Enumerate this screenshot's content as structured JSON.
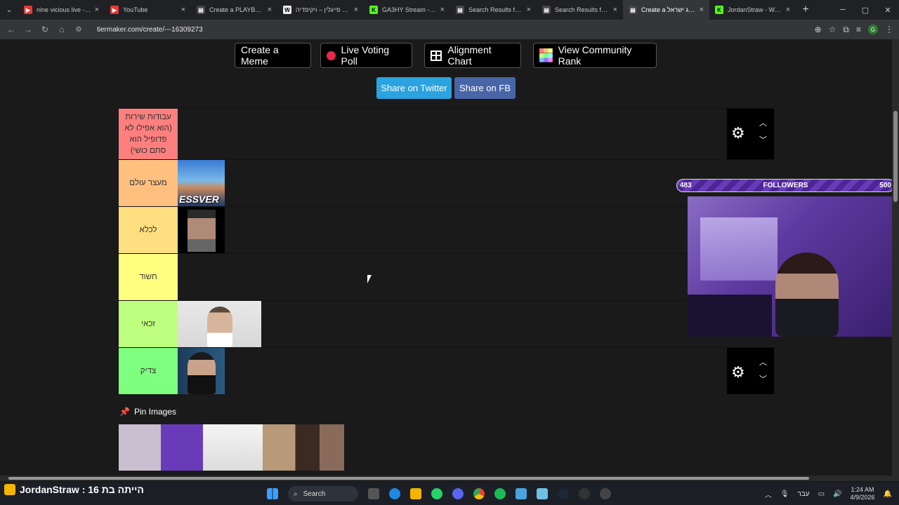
{
  "browser": {
    "tabs": [
      {
        "title": "nine vicious live - You",
        "fav": "▶",
        "favColor": "#e53935"
      },
      {
        "title": "YouTube",
        "fav": "▶",
        "favColor": "#e53935"
      },
      {
        "title": "Create a PLAYBOI CA",
        "fav": "▤",
        "favColor": "#444"
      },
      {
        "title": "משה פייגלין – ויקיפדיה",
        "fav": "W",
        "favColor": "#eee"
      },
      {
        "title": "GA3HY Stream - Wat",
        "fav": "K",
        "favColor": "#53fc18"
      },
      {
        "title": "Search Results for 'ט",
        "fav": "▤",
        "favColor": "#444"
      },
      {
        "title": "Search Results for 'ט",
        "fav": "▤",
        "favColor": "#444"
      },
      {
        "title": "Create a דירוג ישראל",
        "fav": "▤",
        "favColor": "#444"
      },
      {
        "title": "JordanStraw - Watch",
        "fav": "K",
        "favColor": "#53fc18"
      }
    ],
    "active_tab_index": 7,
    "url": "tiermaker.com/create/---16309273",
    "profile_initial": "G"
  },
  "toolbar_buttons": {
    "meme": "Create a Meme",
    "poll": "Live Voting Poll",
    "alignment": "Alignment Chart",
    "community": "View Community Rank"
  },
  "share": {
    "twitter": "Share on Twitter",
    "fb": "Share on FB"
  },
  "tiers": [
    {
      "label": "עבודות שירות (הוא אפילו לא פדופיל הוא סתם כושי)",
      "color": "#ff7f7f"
    },
    {
      "label": "מעצר עולם",
      "color": "#ffbf7f"
    },
    {
      "label": "לכלא",
      "color": "#ffdf7f"
    },
    {
      "label": "חשוד",
      "color": "#ffff7f"
    },
    {
      "label": "זכאי",
      "color": "#bfff7f"
    },
    {
      "label": "צדיק",
      "color": "#7fff7f"
    }
  ],
  "tier_item_label": "ESSVER",
  "pin_images_label": "Pin Images",
  "followers_widget": {
    "current": "483",
    "label": "FOLLOWERS",
    "goal": "500"
  },
  "stream_overlay": {
    "text": "הייתה בת 16 : JordanStraw"
  },
  "taskbar": {
    "search_label": "Search",
    "lang": "עבר",
    "time": "1:24 AM",
    "date": "4/9/2026"
  }
}
